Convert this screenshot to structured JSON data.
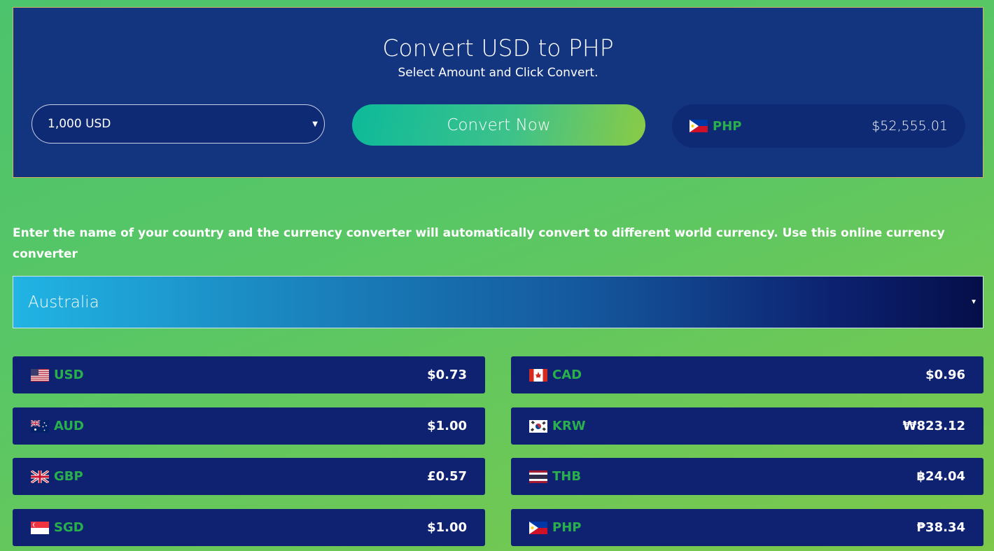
{
  "header": {
    "title": "Convert USD to PHP",
    "subtitle": "Select Amount and Click Convert.",
    "amount_selected": "1,000 USD",
    "convert_label": "Convert Now",
    "result_currency": "PHP",
    "result_value": "$52,555.01"
  },
  "intro": "Enter the name of your country and the currency converter will automatically convert to different world currency. Use this online currency converter",
  "country_selected": "Australia",
  "rates": [
    {
      "code": "USD",
      "value": "$0.73",
      "flag": "us-flag-icon"
    },
    {
      "code": "CAD",
      "value": "$0.96",
      "flag": "ca-flag-icon"
    },
    {
      "code": "AUD",
      "value": "$1.00",
      "flag": "au-flag-icon"
    },
    {
      "code": "KRW",
      "value": "₩823.12",
      "flag": "kr-flag-icon"
    },
    {
      "code": "GBP",
      "value": "£0.57",
      "flag": "gb-flag-icon"
    },
    {
      "code": "THB",
      "value": "฿24.04",
      "flag": "th-flag-icon"
    },
    {
      "code": "SGD",
      "value": "$1.00",
      "flag": "sg-flag-icon"
    },
    {
      "code": "PHP",
      "value": "₱38.34",
      "flag": "ph-flag-icon"
    }
  ],
  "colors": {
    "card_bg": "#13347f",
    "row_bg": "#0e2271",
    "code_green": "#29b04c",
    "page_gradient_start": "#4cc36d",
    "page_gradient_end": "#7ec84a"
  }
}
